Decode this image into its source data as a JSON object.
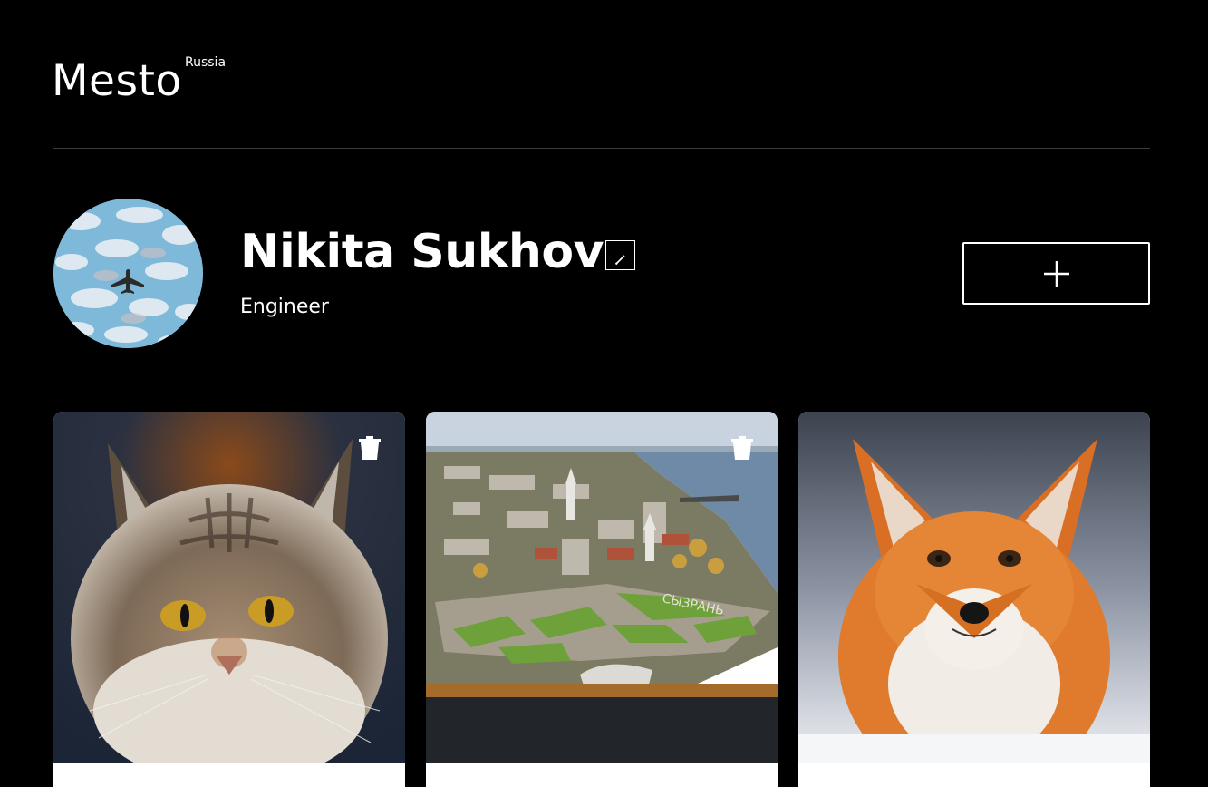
{
  "header": {
    "logo_text": "Mesto",
    "logo_superscript": "Russia"
  },
  "profile": {
    "name": "Nikita Sukhov",
    "about": "Engineer",
    "avatar_icon": "airplane-in-sky-avatar",
    "edit_icon": "pencil-icon",
    "add_icon": "plus-icon"
  },
  "cards": [
    {
      "image": "maine-coon-cat-photo",
      "title": "",
      "has_delete": true
    },
    {
      "image": "syzran-city-aerial-photo",
      "title": "",
      "has_delete": true,
      "image_text": "СЫЗРАНЬ"
    },
    {
      "image": "red-fox-photo",
      "title": "",
      "has_delete": false
    }
  ],
  "colors": {
    "background": "#000000",
    "text": "#ffffff",
    "divider": "#545454"
  }
}
